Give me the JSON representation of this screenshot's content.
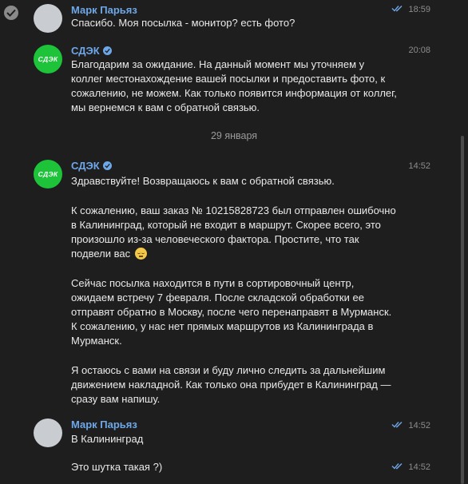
{
  "date_separator": "29 января",
  "messages": [
    {
      "sender": "Марк Парьяз",
      "time": "18:59",
      "lines": [
        "Спасибо. Моя посылка - монитор? есть фото?"
      ]
    },
    {
      "sender": "СДЭК",
      "time": "20:08",
      "lines": [
        "Благодарим за ожидание. На данный момент мы уточняем у",
        "коллег местонахождение вашей посылки и предоставить фото, к",
        "сожалению, не можем. Как только появится информация от коллег,",
        "мы вернемся к вам с обратной связью."
      ]
    },
    {
      "sender": "СДЭК",
      "time": "14:52",
      "p1": [
        "Здравствуйте! Возвращаюсь к вам с обратной связью."
      ],
      "p2": [
        "К сожалению, ваш заказ № 10215828723 был отправлен ошибочно",
        "в Калининград, который не входит в маршрут. Скорее всего, это",
        "произошло из-за человеческого фактора. Простите, что так",
        "подвели вас"
      ],
      "p3": [
        "Сейчас посылка находится в пути в сортировочный центр,",
        "ожидаем встречу 7 февраля. После складской обработки ее",
        "отправят обратно в Москву, после чего перенаправят в Мурманск.",
        "К сожалению, у нас нет прямых маршрутов из Калининграда в",
        "Мурманск."
      ],
      "p4": [
        "Я остаюсь с вами на связи и буду лично следить за дальнейшим",
        "движением накладной. Как только она прибудет в Калининград —",
        "сразу вам напишу."
      ]
    },
    {
      "sender": "Марк Парьяз",
      "time": "14:52",
      "lines": [
        "В Калининград"
      ]
    },
    {
      "time": "14:52",
      "lines": [
        "Это шутка такая ?)"
      ]
    }
  ],
  "cdek_logo_text": "СДЭК",
  "icons": {
    "select": "check-circle-icon",
    "read": "double-check-icon",
    "verified": "verified-badge-icon",
    "emoji": "relieved-face-emoji"
  },
  "colors": {
    "background": "#1e1e1e",
    "sender_name": "#6ea7e8",
    "cdek_green": "#1dc43a",
    "read_ticks": "#6ea7e8"
  }
}
